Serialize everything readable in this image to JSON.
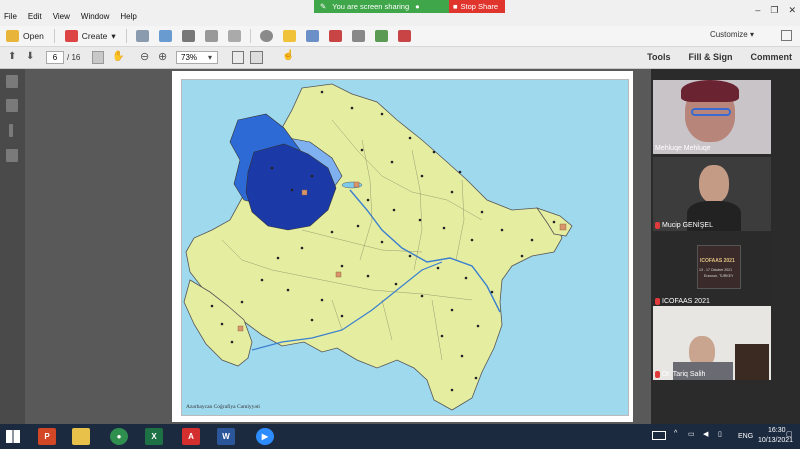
{
  "menu": [
    "File",
    "Edit",
    "View",
    "Window",
    "Help"
  ],
  "sharing": {
    "status": "You are screen sharing",
    "stop": "Stop Share",
    "status_color": "#3fa649",
    "stop_color": "#e0352d"
  },
  "toolbar": {
    "open": "Open",
    "create": "Create",
    "customize": "Customize"
  },
  "nav": {
    "page_current": "6",
    "page_total": "/ 16",
    "zoom": "73%"
  },
  "right_panel_links": [
    "Tools",
    "Fill & Sign",
    "Comment"
  ],
  "map": {
    "credit": "Azərbaycan Coğrafiya Cəmiyyəti",
    "colors": {
      "sea": "#9fd9ee",
      "land": "#e4eda0",
      "dark_region": "#1b3aa8",
      "mid_region": "#2e6ad6",
      "light_region": "#7fb0ef",
      "river": "#3a7fd0"
    }
  },
  "participants": [
    {
      "name": "Mehluqe Mehluqe",
      "muted": false
    },
    {
      "name": "Mucip GENİŞEL",
      "muted": true
    },
    {
      "name": "ICOFAAS 2021",
      "muted": true
    },
    {
      "name": "Dr. Tariq Salih",
      "muted": true
    }
  ],
  "poster": {
    "line1": "ICOFAAS 2021",
    "line2": "13 - 17 October 2021",
    "line3": "Erzurum, TURKEY"
  },
  "tray": {
    "language": "ENG",
    "time": "16:30",
    "date": "10/13/2021"
  }
}
